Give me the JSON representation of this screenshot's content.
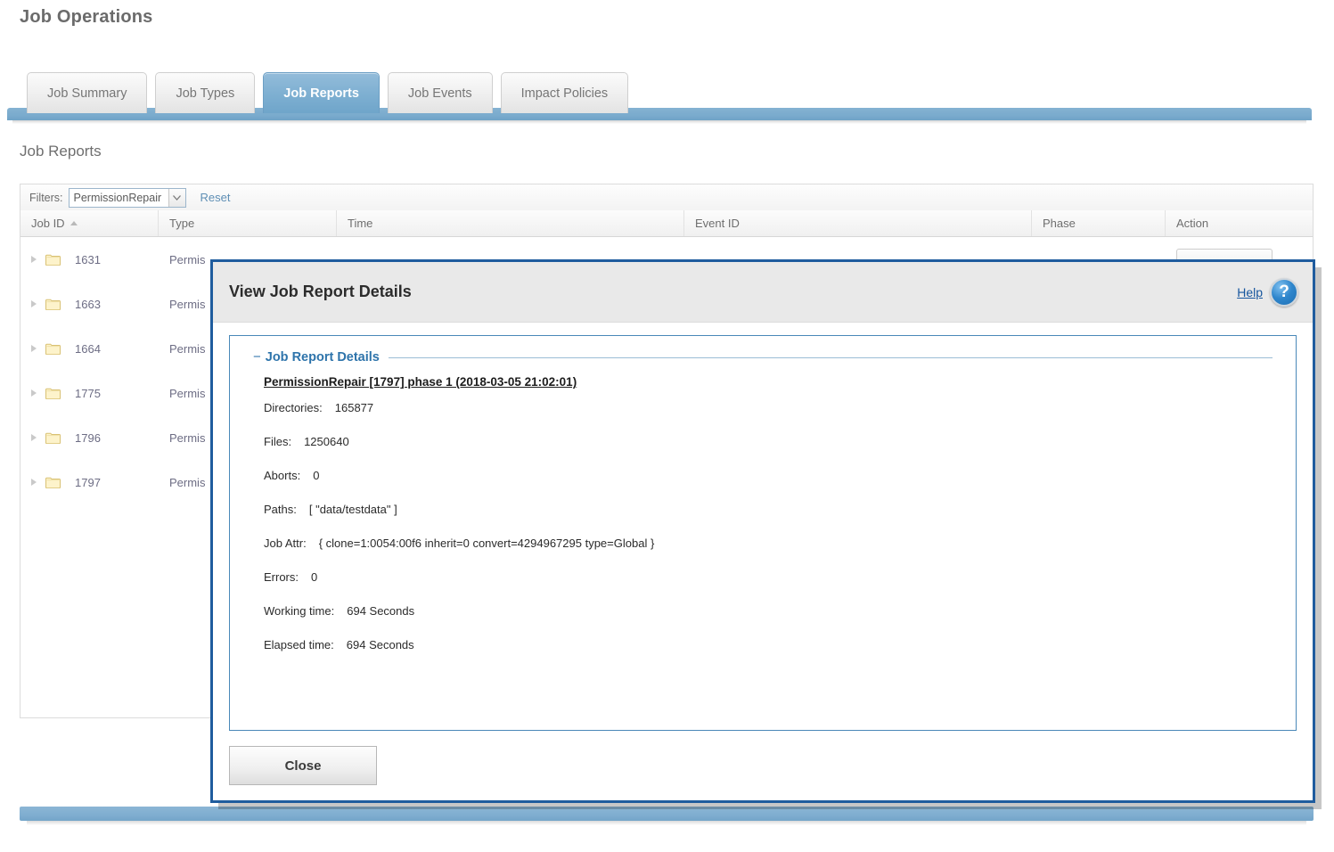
{
  "page": {
    "title": "Job Operations",
    "section_title": "Job Reports"
  },
  "tabs": [
    {
      "label": "Job Summary",
      "active": false
    },
    {
      "label": "Job Types",
      "active": false
    },
    {
      "label": "Job Reports",
      "active": true
    },
    {
      "label": "Job Events",
      "active": false
    },
    {
      "label": "Impact Policies",
      "active": false
    }
  ],
  "filters": {
    "label": "Filters:",
    "selected_value": "PermissionRepair",
    "placeholder": "PermissionRepair",
    "dropdown_icon": "chevron-down-icon",
    "reset_label": "Reset"
  },
  "table": {
    "columns": [
      {
        "label": "Job ID",
        "sorted": true,
        "sort_direction": "asc"
      },
      {
        "label": "Type",
        "sorted": false
      },
      {
        "label": "Time",
        "sorted": false
      },
      {
        "label": "Event ID",
        "sorted": false
      },
      {
        "label": "Phase",
        "sorted": false
      },
      {
        "label": "Action",
        "sorted": false
      }
    ],
    "rows": [
      {
        "job_id": "1631",
        "type": "Permis",
        "time": "",
        "event_id": "",
        "phase": "",
        "action": ""
      },
      {
        "job_id": "1663",
        "type": "Permis",
        "time": "",
        "event_id": "",
        "phase": "",
        "action": ""
      },
      {
        "job_id": "1664",
        "type": "Permis",
        "time": "",
        "event_id": "",
        "phase": "",
        "action": ""
      },
      {
        "job_id": "1775",
        "type": "Permis",
        "time": "",
        "event_id": "",
        "phase": "",
        "action": ""
      },
      {
        "job_id": "1796",
        "type": "Permis",
        "time": "",
        "event_id": "",
        "phase": "",
        "action": ""
      },
      {
        "job_id": "1797",
        "type": "Permis",
        "time": "",
        "event_id": "",
        "phase": "",
        "action": ""
      }
    ],
    "row_icon": "folder-icon",
    "expander_icon": "chevron-right-icon"
  },
  "dialog": {
    "title": "View Job Report Details",
    "help_label": "Help",
    "help_icon": "question-mark-circle-icon",
    "panel": {
      "legend": "Job Report Details",
      "collapse_toggle": "−",
      "report_heading": "PermissionRepair [1797] phase 1 (2018-03-05 21:02:01)",
      "rows": [
        {
          "label": "Directories:",
          "value": "165877"
        },
        {
          "label": "Files:",
          "value": "1250640"
        },
        {
          "label": "Aborts:",
          "value": "0"
        },
        {
          "label": "Paths:",
          "value": "[ \"data/testdata\" ]"
        },
        {
          "label": "Job Attr:",
          "value": "{ clone=1:0054:00f6 inherit=0 convert=4294967295 type=Global }"
        },
        {
          "label": "Errors:",
          "value": "0"
        },
        {
          "label": "Working time:",
          "value": "694 Seconds"
        },
        {
          "label": "Elapsed time:",
          "value": "694 Seconds"
        }
      ]
    },
    "close_label": "Close"
  },
  "colors": {
    "accent_blue": "#7fb0d2",
    "dialog_border": "#1f5c9e",
    "link_blue": "#17569e",
    "panel_border": "#4a88b8",
    "folder_yellow": "#f7e6a8"
  }
}
